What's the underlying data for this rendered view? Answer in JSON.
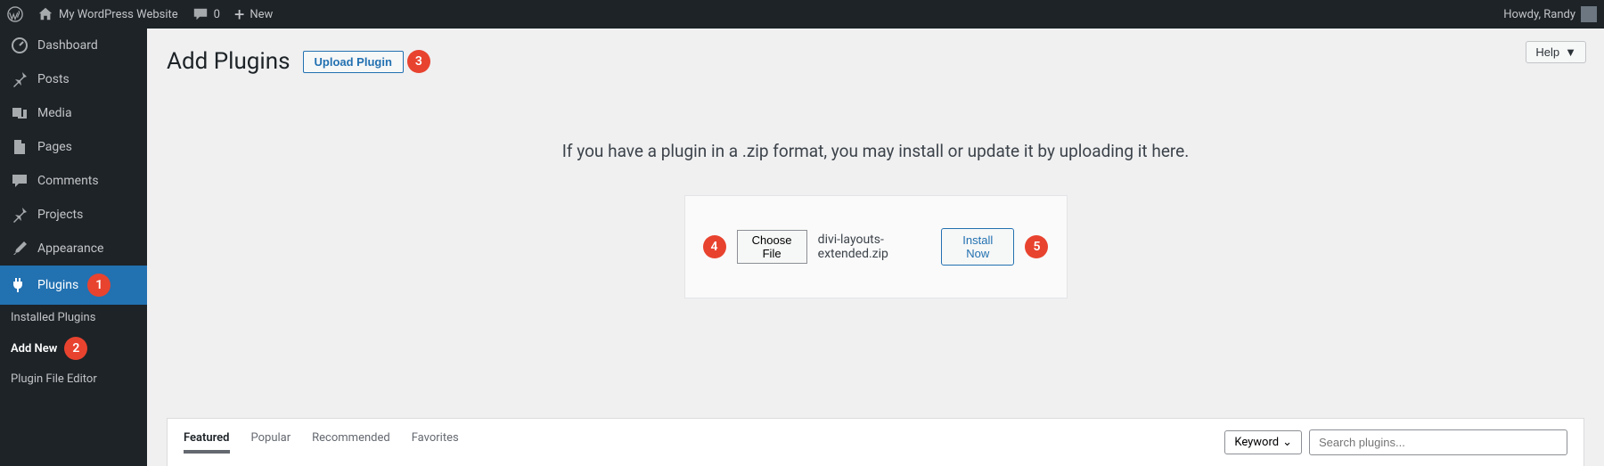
{
  "adminbar": {
    "site_name": "My WordPress Website",
    "comments_count": "0",
    "new_label": "New",
    "greeting": "Howdy, Randy"
  },
  "sidebar": {
    "dashboard": "Dashboard",
    "posts": "Posts",
    "media": "Media",
    "pages": "Pages",
    "comments": "Comments",
    "projects": "Projects",
    "appearance": "Appearance",
    "plugins": "Plugins",
    "sub_installed": "Installed Plugins",
    "sub_add_new": "Add New",
    "sub_editor": "Plugin File Editor"
  },
  "main": {
    "help": "Help",
    "title": "Add Plugins",
    "upload_button": "Upload Plugin",
    "upload_hint": "If you have a plugin in a .zip format, you may install or update it by uploading it here.",
    "choose_file": "Choose File",
    "file_name": "divi-layouts-extended.zip",
    "install_now": "Install Now"
  },
  "filter": {
    "tabs": {
      "featured": "Featured",
      "popular": "Popular",
      "recommended": "Recommended",
      "favorites": "Favorites"
    },
    "keyword": "Keyword",
    "search_placeholder": "Search plugins..."
  },
  "annotations": {
    "a1": "1",
    "a2": "2",
    "a3": "3",
    "a4": "4",
    "a5": "5"
  }
}
